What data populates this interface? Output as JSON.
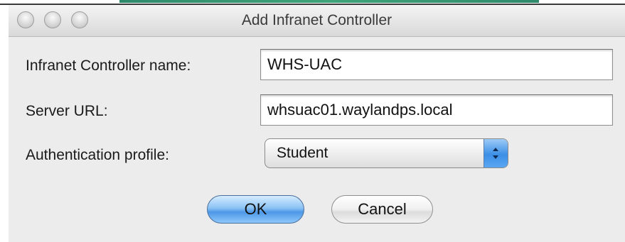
{
  "window": {
    "title": "Add Infranet Controller"
  },
  "form": {
    "controller_name": {
      "label": "Infranet Controller name:",
      "value": "WHS-UAC"
    },
    "server_url": {
      "label": "Server URL:",
      "value": "whsuac01.waylandps.local"
    },
    "auth_profile": {
      "label": "Authentication profile:",
      "value": "Student"
    }
  },
  "buttons": {
    "ok_label": "OK",
    "cancel_label": "Cancel"
  },
  "colors": {
    "window_bg": "#ececec",
    "default_button": "#4d98e6",
    "select_arrow": "#3b8fe6"
  }
}
